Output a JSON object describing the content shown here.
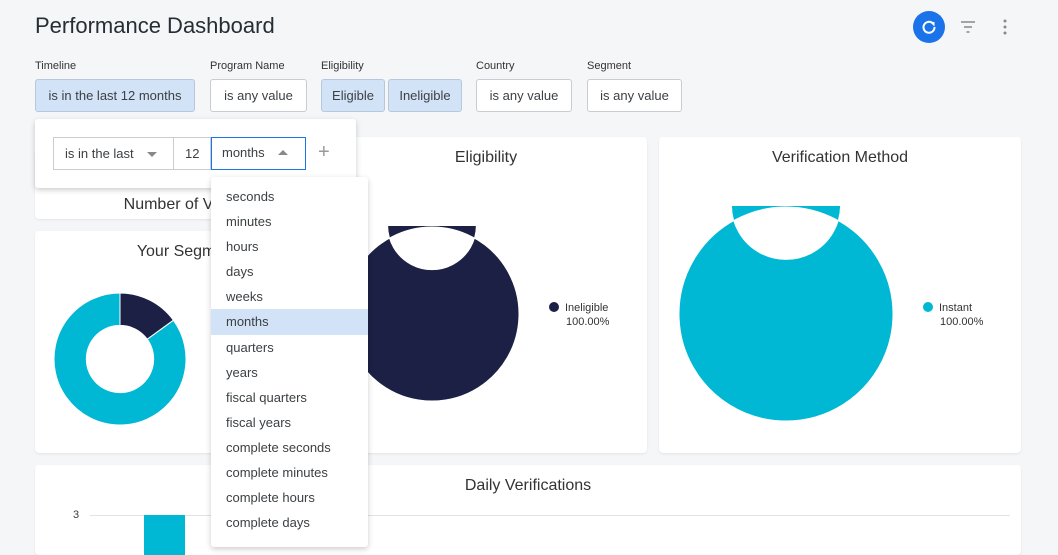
{
  "header": {
    "title": "Performance Dashboard",
    "icons": [
      "refresh-icon",
      "filter-icon",
      "more-vert-icon"
    ],
    "accent": "#1a73e8"
  },
  "filters": [
    {
      "label": "Timeline",
      "values": [
        "is in the last 12 months"
      ]
    },
    {
      "label": "Program Name",
      "values": [
        "is any value"
      ]
    },
    {
      "label": "Eligibility",
      "values": [
        "Eligible",
        "Ineligible"
      ]
    },
    {
      "label": "Country",
      "values": [
        "is any value"
      ]
    },
    {
      "label": "Segment",
      "values": [
        "is any value"
      ]
    }
  ],
  "timeline_editor": {
    "operator": "is in the last",
    "amount": "12",
    "unit": "months",
    "add_label": "+"
  },
  "unit_options": [
    "seconds",
    "minutes",
    "hours",
    "days",
    "weeks",
    "months",
    "quarters",
    "years",
    "fiscal quarters",
    "fiscal years",
    "complete seconds",
    "complete minutes",
    "complete hours",
    "complete days"
  ],
  "selected_unit": "months",
  "cards": {
    "number_title": "Number of Verific",
    "segment_title": "Your Segmen",
    "eligibility_title": "Eligibility",
    "verification_title": "Verification Method",
    "daily_title": "Daily Verifications"
  },
  "chart_data": [
    {
      "type": "pie",
      "title": "Your Segmen",
      "slices": [
        {
          "value": 85,
          "color": "#00b8d4"
        },
        {
          "value": 15,
          "color": "#1b2044"
        }
      ]
    },
    {
      "type": "pie",
      "title": "Eligibility",
      "slices": [
        {
          "name": "Ineligible",
          "value": 100,
          "label": "100.00%",
          "color": "#1b2044"
        }
      ]
    },
    {
      "type": "pie",
      "title": "Verification Method",
      "slices": [
        {
          "name": "Instant",
          "value": 100,
          "label": "100.00%",
          "color": "#00b8d4"
        }
      ]
    },
    {
      "type": "bar",
      "title": "Daily Verifications",
      "yticks": [
        "3"
      ],
      "values": [
        3
      ],
      "color": "#00b8d4"
    }
  ]
}
